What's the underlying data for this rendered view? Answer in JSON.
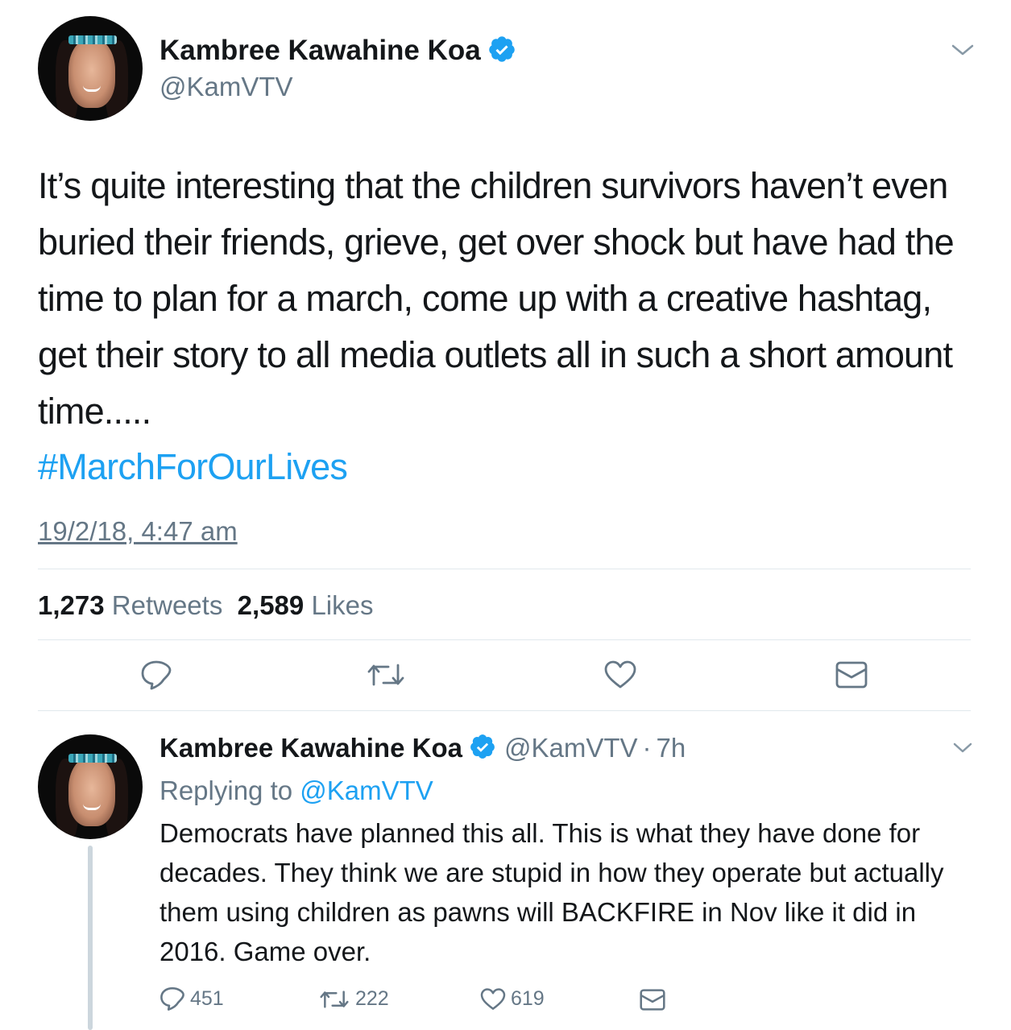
{
  "main_tweet": {
    "author_name": "Kambree Kawahine Koa",
    "author_handle": "@KamVTV",
    "text": "It’s quite interesting that the children survivors haven’t even buried their friends, grieve, get over shock but have had the time to plan for a march, come up with a creative hashtag, get their story to all media outlets all in such a short amount time.....",
    "hashtag": "#MarchForOurLives",
    "timestamp": "19/2/18, 4:47 am",
    "retweets_count": "1,273",
    "retweets_label": "Retweets",
    "likes_count": "2,589",
    "likes_label": "Likes",
    "actions": [
      "reply-icon",
      "retweet-icon",
      "like-icon",
      "message-icon"
    ]
  },
  "reply_tweet": {
    "author_name": "Kambree Kawahine Koa",
    "author_handle": "@KamVTV",
    "separator": "·",
    "age": "7h",
    "replying_label": "Replying to",
    "replying_handle": "@KamVTV",
    "text": "Democrats have planned this all. This is what they have done for decades. They think we are stupid in how they operate but actually them using children as pawns will BACKFIRE in Nov like it did in 2016. Game over.",
    "reply_count": "451",
    "retweet_count": "222",
    "like_count": "619"
  },
  "colors": {
    "accent": "#1da1f2",
    "secondary_text": "#657786",
    "primary_text": "#14171a",
    "divider": "#e1e8ed"
  }
}
